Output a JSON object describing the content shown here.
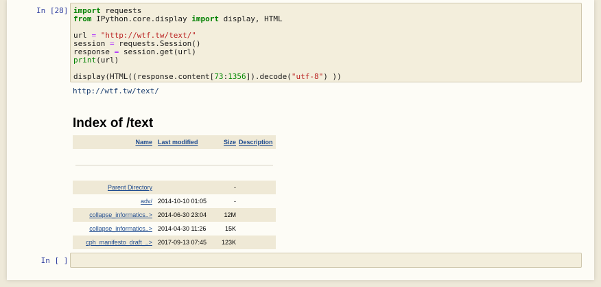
{
  "cells": [
    {
      "prompt": "In [28]:",
      "code_lines": [
        "import requests",
        "from IPython.core.display import display, HTML",
        "",
        "url = \"http://wtf.tw/text/\"",
        "session = requests.Session()",
        "response = session.get(url)",
        "print(url)",
        "",
        "display(HTML((response.content[73:1356]).decode(\"utf-8\") ))"
      ],
      "output_text": "http://wtf.tw/text/",
      "html_output": {
        "title": "Index of /text",
        "columns": [
          "Name",
          "Last modified",
          "Size",
          "Description"
        ],
        "rows": [
          {
            "name": "Parent Directory",
            "modified": "",
            "size": "-"
          },
          {
            "name": "adv/",
            "modified": "2014-10-10 01:05",
            "size": "-"
          },
          {
            "name": "collapse_informatics..>",
            "modified": "2014-06-30 23:04",
            "size": "12M"
          },
          {
            "name": "collapse_informatics..>",
            "modified": "2014-04-30 11:26",
            "size": "15K"
          },
          {
            "name": "cph_manifesto_draft_..>",
            "modified": "2017-09-13 07:45",
            "size": "123K"
          }
        ]
      }
    },
    {
      "prompt": "In [ ]:",
      "code_lines": []
    }
  ],
  "colors": {
    "prompt": "#303f9f",
    "keyword": "#008000",
    "string": "#ba2121",
    "number": "#008800",
    "link": "#1e4b8f",
    "cell_bg": "#f3eedc"
  }
}
